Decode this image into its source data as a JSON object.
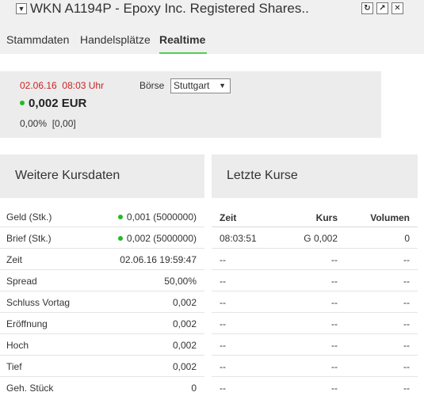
{
  "window": {
    "title": "WKN A1194P - Epoxy Inc. Registered Shares.."
  },
  "tabs": [
    {
      "label": "Stammdaten",
      "active": false
    },
    {
      "label": "Handelsplätze",
      "active": false
    },
    {
      "label": "Realtime",
      "active": true
    }
  ],
  "quote": {
    "date": "02.06.16",
    "time": "08:03 Uhr",
    "price": "0,002 EUR",
    "change": "0,00%",
    "change_abs": "[0,00]",
    "exchange_label": "Börse",
    "exchange_selected": "Stuttgart"
  },
  "weitere_kursdaten": {
    "title": "Weitere Kursdaten",
    "rows": [
      {
        "label": "Geld (Stk.)",
        "value": "0,001 (5000000)",
        "dot": true
      },
      {
        "label": "Brief (Stk.)",
        "value": "0,002 (5000000)",
        "dot": true
      },
      {
        "label": "Zeit",
        "value": "02.06.16 19:59:47",
        "dot": false
      },
      {
        "label": "Spread",
        "value": "50,00%",
        "dot": false
      },
      {
        "label": "Schluss Vortag",
        "value": "0,002",
        "dot": false
      },
      {
        "label": "Eröffnung",
        "value": "0,002",
        "dot": false
      },
      {
        "label": "Hoch",
        "value": "0,002",
        "dot": false
      },
      {
        "label": "Tief",
        "value": "0,002",
        "dot": false
      },
      {
        "label": "Geh. Stück",
        "value": "0",
        "dot": false
      }
    ]
  },
  "letzte_kurse": {
    "title": "Letzte Kurse",
    "columns": [
      "Zeit",
      "Kurs",
      "Volumen"
    ],
    "rows": [
      [
        "08:03:51",
        "G 0,002",
        "0"
      ],
      [
        "--",
        "--",
        "--"
      ],
      [
        "--",
        "--",
        "--"
      ],
      [
        "--",
        "--",
        "--"
      ],
      [
        "--",
        "--",
        "--"
      ],
      [
        "--",
        "--",
        "--"
      ],
      [
        "--",
        "--",
        "--"
      ],
      [
        "--",
        "--",
        "--"
      ]
    ]
  },
  "colors": {
    "accent_green": "#55cc55",
    "status_dot": "#22bb22",
    "date_red": "#cc2222"
  }
}
